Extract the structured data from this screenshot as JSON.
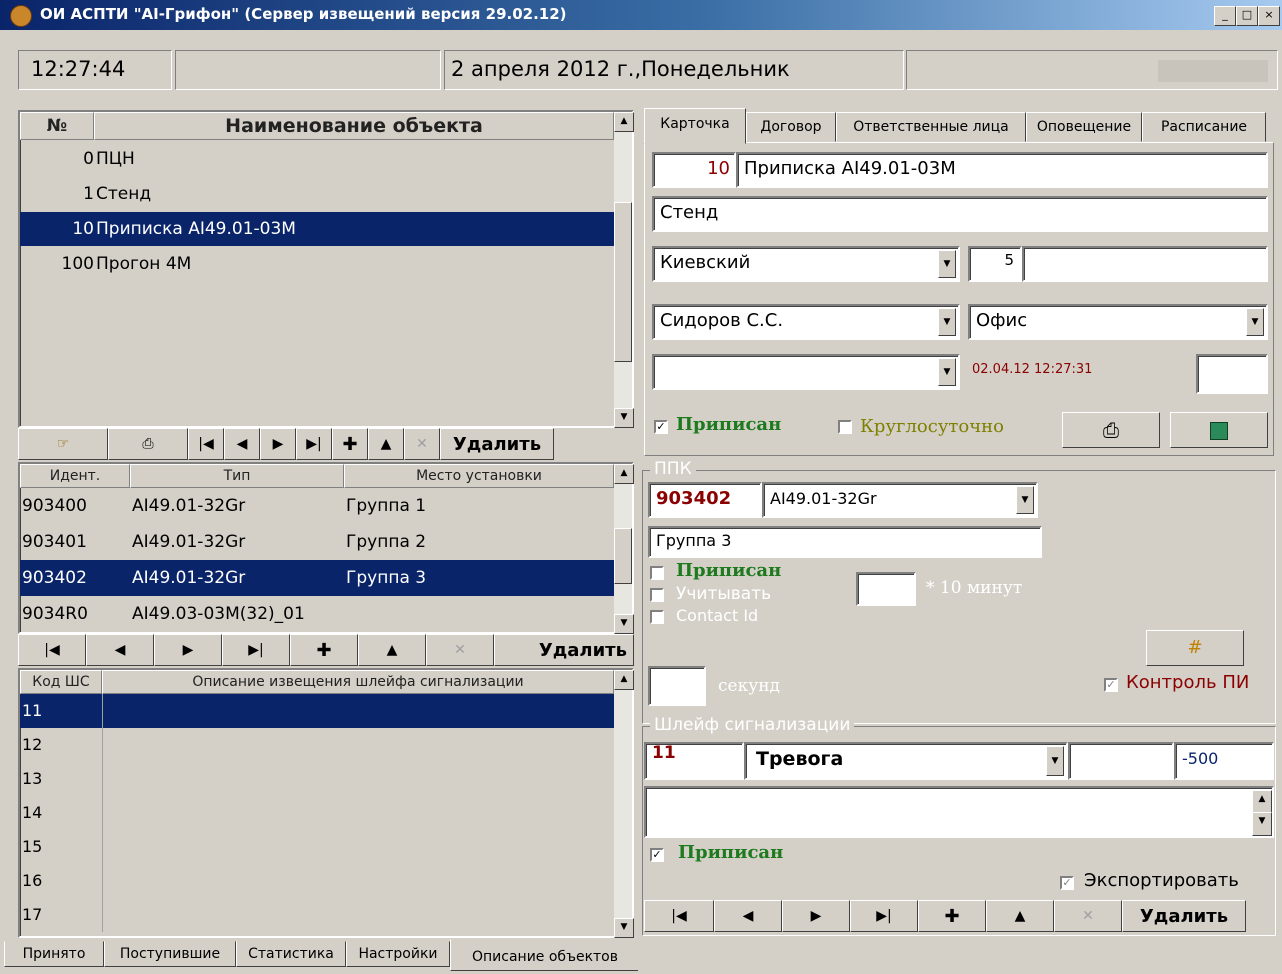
{
  "window": {
    "title": "ОИ АСПТИ \"AI-Грифон\" (Сервер извещений версия 29.02.12)",
    "min": "_",
    "max": "□",
    "close": "×"
  },
  "status": {
    "time": "12:27:44",
    "date": "2 апреля 2012 г.,Понедельник"
  },
  "objects": {
    "col_num": "№",
    "col_name": "Наименование объекта",
    "rows": [
      {
        "num": "0",
        "name": "ПЦН"
      },
      {
        "num": "1",
        "name": "Стенд"
      },
      {
        "num": "10",
        "name": "Приписка AI49.01-03M"
      },
      {
        "num": "100",
        "name": "Прогон 4M"
      }
    ],
    "delete_label": "Удалить"
  },
  "devices": {
    "col_id": "Идент.",
    "col_type": "Тип",
    "col_place": "Место установки",
    "rows": [
      {
        "id": "903400",
        "type": "AI49.01-32Gr",
        "place": "Группа 1"
      },
      {
        "id": "903401",
        "type": "AI49.01-32Gr",
        "place": "Группа 2"
      },
      {
        "id": "903402",
        "type": "AI49.01-32Gr",
        "place": "Группа 3"
      },
      {
        "id": "9034R0",
        "type": "AI49.03-03M(32)_01",
        "place": ""
      }
    ],
    "delete_label": "Удалить"
  },
  "loops": {
    "col_code": "Код ШС",
    "col_desc": "Описание извещения шлейфа сигнализации",
    "rows": [
      "11",
      "12",
      "13",
      "14",
      "15",
      "16",
      "17"
    ]
  },
  "bottom_tabs": [
    "Принято",
    "Поступившие",
    "Статистика",
    "Настройки",
    "Описание объектов"
  ],
  "right_tabs": [
    "Карточка",
    "Договор",
    "Ответственные лица",
    "Оповещение",
    "Расписание"
  ],
  "card": {
    "num": "10",
    "name": "Приписка AI49.01-03M",
    "group": "Стенд",
    "district": "Киевский",
    "district_code": "5",
    "district_extra": "",
    "person": "Сидоров С.С.",
    "place": "Офис",
    "empty_select": "",
    "timestamp": "02.04.12 12:27:31",
    "small_field": "",
    "assigned": "Приписан",
    "round_clock": "Круглосуточно"
  },
  "ppk": {
    "legend": "ППК",
    "id": "903402",
    "type": "AI49.01-32Gr",
    "place": "Группа 3",
    "assigned": "Приписан",
    "consider": "Учитывать",
    "contact_id": "Contact Id",
    "minutes_value": "",
    "minutes_label": "* 10 минут",
    "seconds_value": "",
    "seconds_label": "секунд",
    "control_pi": "Контроль ПИ"
  },
  "loop": {
    "legend": "Шлейф сигнализации",
    "code": "11",
    "event": "Тревога",
    "extra": "",
    "value": "-500",
    "description": "",
    "assigned": "Приписан",
    "export": "Экспортировать",
    "delete_label": "Удалить"
  },
  "colors": {
    "selection": "#0a246a",
    "dark_red": "#8b0000",
    "green": "#1e7a1e",
    "olive": "#808000"
  }
}
